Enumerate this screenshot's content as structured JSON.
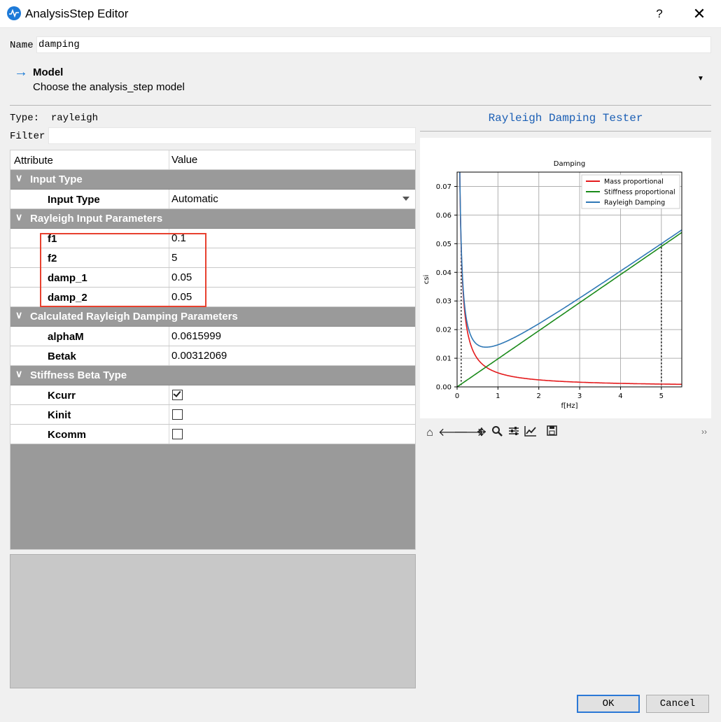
{
  "window": {
    "title": "AnalysisStep Editor",
    "help": "?",
    "close": "✕"
  },
  "name": {
    "label": "Name",
    "value": "damping"
  },
  "model": {
    "title": "Model",
    "description": "Choose the analysis_step model"
  },
  "type": {
    "label": "Type:",
    "value": "rayleigh"
  },
  "filter": {
    "label": "Filter",
    "value": ""
  },
  "grid": {
    "headers": {
      "attribute": "Attribute",
      "value": "Value"
    },
    "groups": {
      "input_type": "Input Type",
      "rayleigh_input": "Rayleigh Input Parameters",
      "calculated": "Calculated Rayleigh Damping Parameters",
      "stiffness_beta": "Stiffness Beta Type"
    },
    "props": {
      "input_type": {
        "label": "Input Type",
        "value": "Automatic"
      },
      "f1": {
        "label": "f1",
        "value": "0.1"
      },
      "f2": {
        "label": "f2",
        "value": "5"
      },
      "damp_1": {
        "label": "damp_1",
        "value": "0.05"
      },
      "damp_2": {
        "label": "damp_2",
        "value": "0.05"
      },
      "alphaM": {
        "label": "alphaM",
        "value": "0.0615999"
      },
      "betaK": {
        "label": "Betak",
        "value": "0.00312069"
      },
      "kcurr": {
        "label": "Kcurr",
        "checked": true
      },
      "kinit": {
        "label": "Kinit",
        "checked": false
      },
      "kcomm": {
        "label": "Kcomm",
        "checked": false
      }
    }
  },
  "tester": {
    "title": "Rayleigh Damping Tester"
  },
  "buttons": {
    "ok": "OK",
    "cancel": "Cancel"
  },
  "chart_data": {
    "type": "line",
    "title": "Damping",
    "xlabel": "f[Hz]",
    "ylabel": "csi",
    "xlim": [
      0,
      5.5
    ],
    "ylim": [
      0,
      0.075
    ],
    "xticks": [
      "0",
      "1",
      "2",
      "3",
      "4",
      "5"
    ],
    "yticks": [
      "0.00",
      "0.01",
      "0.02",
      "0.03",
      "0.04",
      "0.05",
      "0.06",
      "0.07"
    ],
    "grid": true,
    "legend_position": "top-right",
    "alphaM": 0.0615999,
    "betaK": 0.00312069,
    "series": [
      {
        "name": "Mass proportional",
        "color": "#e41a1c",
        "formula": "alphaM/(4*pi*f)"
      },
      {
        "name": "Stiffness proportional",
        "color": "#1a8a1a",
        "formula": "betaK*pi*f"
      },
      {
        "name": "Rayleigh Damping",
        "color": "#2f78b6",
        "formula": "alphaM/(4*pi*f)+betaK*pi*f"
      }
    ],
    "marker_lines_x": [
      0.1,
      5
    ]
  }
}
